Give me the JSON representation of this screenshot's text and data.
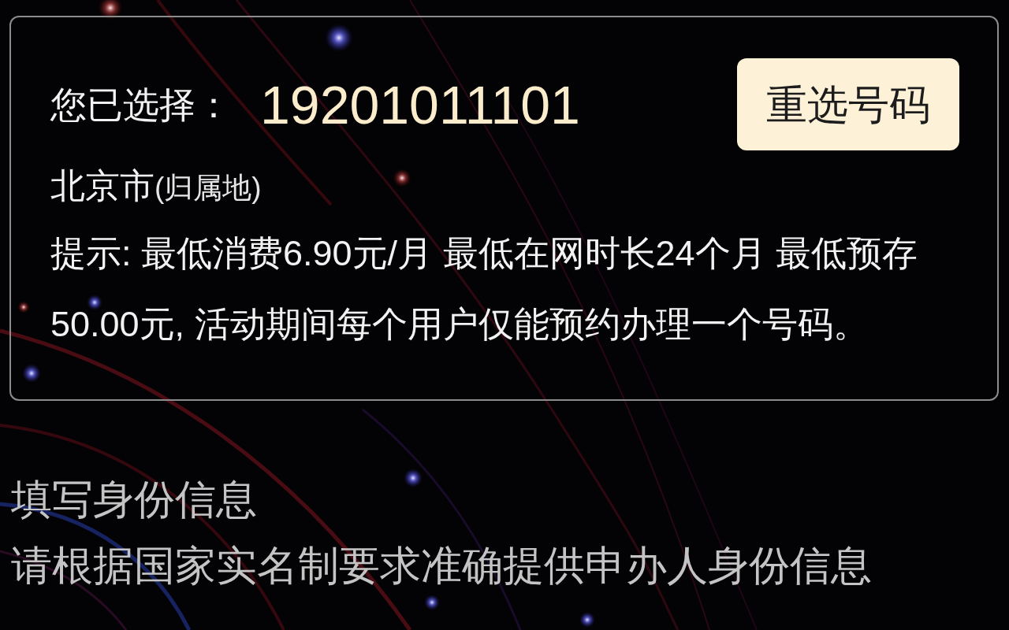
{
  "selection": {
    "label": "您已选择：",
    "number": "19201011101",
    "reselect_button": "重选号码",
    "location": "北京市",
    "location_note": "(归属地)",
    "notice": "提示: 最低消费6.90元/月 最低在网时长24个月 最低预存50.00元, 活动期间每个用户仅能预约办理一个号码。"
  },
  "identity_section": {
    "title": "填写身份信息",
    "description": "请根据国家实名制要求准确提供申办人身份信息"
  }
}
